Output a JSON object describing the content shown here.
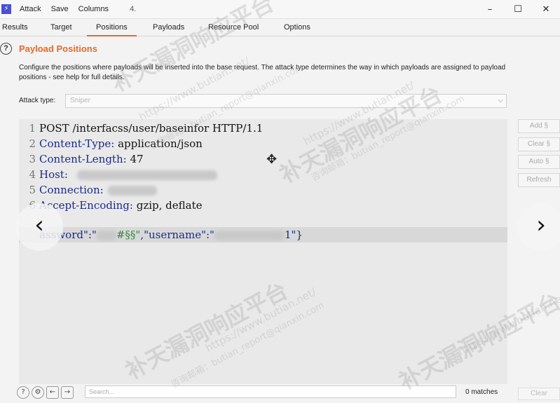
{
  "titlebar": {
    "menus": [
      "Attack",
      "Save",
      "Columns"
    ],
    "title": "4.",
    "controls": [
      "–",
      "☐",
      "✕"
    ]
  },
  "tabs": [
    "Results",
    "Target",
    "Positions",
    "Payloads",
    "Resource Pool",
    "Options"
  ],
  "active_tab": "Positions",
  "section": {
    "title": "Payload Positions",
    "description": "Configure the positions where payloads will be inserted into the base request. The attack type determines the way in which payloads are assigned to payload positions - see help for full details."
  },
  "attack_type": {
    "label": "Attack type:",
    "value": "Sniper"
  },
  "editor": {
    "lines": [
      {
        "num": "1",
        "key": "POST /interfacss/user/baseinfor HTTP/1.1",
        "value": ""
      },
      {
        "num": "2",
        "key": "Content-Type:",
        "value": " application/json"
      },
      {
        "num": "3",
        "key": "Content-Length:",
        "value": " 47"
      },
      {
        "num": "4",
        "key": "Host:",
        "value": ""
      },
      {
        "num": "5",
        "key": "Connection:",
        "value": ""
      },
      {
        "num": "6",
        "key": "Accept-Encoding:",
        "value": " gzip, deflate"
      }
    ],
    "body": {
      "part1": "assword\":\"",
      "marker": "#§§\"",
      "part2": ",\"username\":\"",
      "tail": "1\"}"
    }
  },
  "side_buttons": [
    "Add §",
    "Clear §",
    "Auto §",
    "Refresh"
  ],
  "bottom": {
    "search_placeholder": "Search...",
    "matches": "0 matches",
    "clear": "Clear"
  },
  "nav": {
    "prev": "‹",
    "next": "›"
  },
  "watermark": {
    "big": "补天漏洞响应平台",
    "url": "https://www.butian.net/",
    "email": "咨询邮箱：butian_report@qianxin.com"
  },
  "colors": {
    "accent": "#e8692a",
    "keyword": "#1b2a8a",
    "marker": "#2e8a3e"
  }
}
